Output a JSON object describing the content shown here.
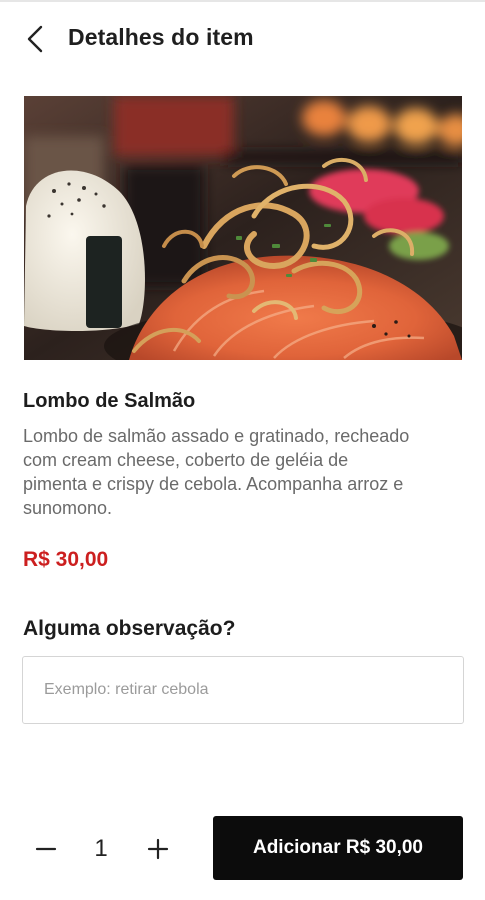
{
  "header": {
    "title": "Detalhes do item",
    "back_icon": "chevron-left-icon"
  },
  "item": {
    "name": "Lombo de Salmão",
    "description": "Lombo de salmão assado e gratinado, recheado com cream cheese, coberto de geléia de pimenta e crispy de cebola. Acompanha arroz e sunomono.",
    "price": "R$ 30,00"
  },
  "observation": {
    "title": "Alguma observação?",
    "placeholder": "Exemplo: retirar cebola",
    "value": ""
  },
  "footer": {
    "quantity": "1",
    "minus_icon": "minus-icon",
    "plus_icon": "plus-icon",
    "add_label": "Adicionar R$ 30,00"
  },
  "colors": {
    "price": "#cc1f1f",
    "button_bg": "#0c0c0c",
    "button_text": "#ffffff"
  }
}
